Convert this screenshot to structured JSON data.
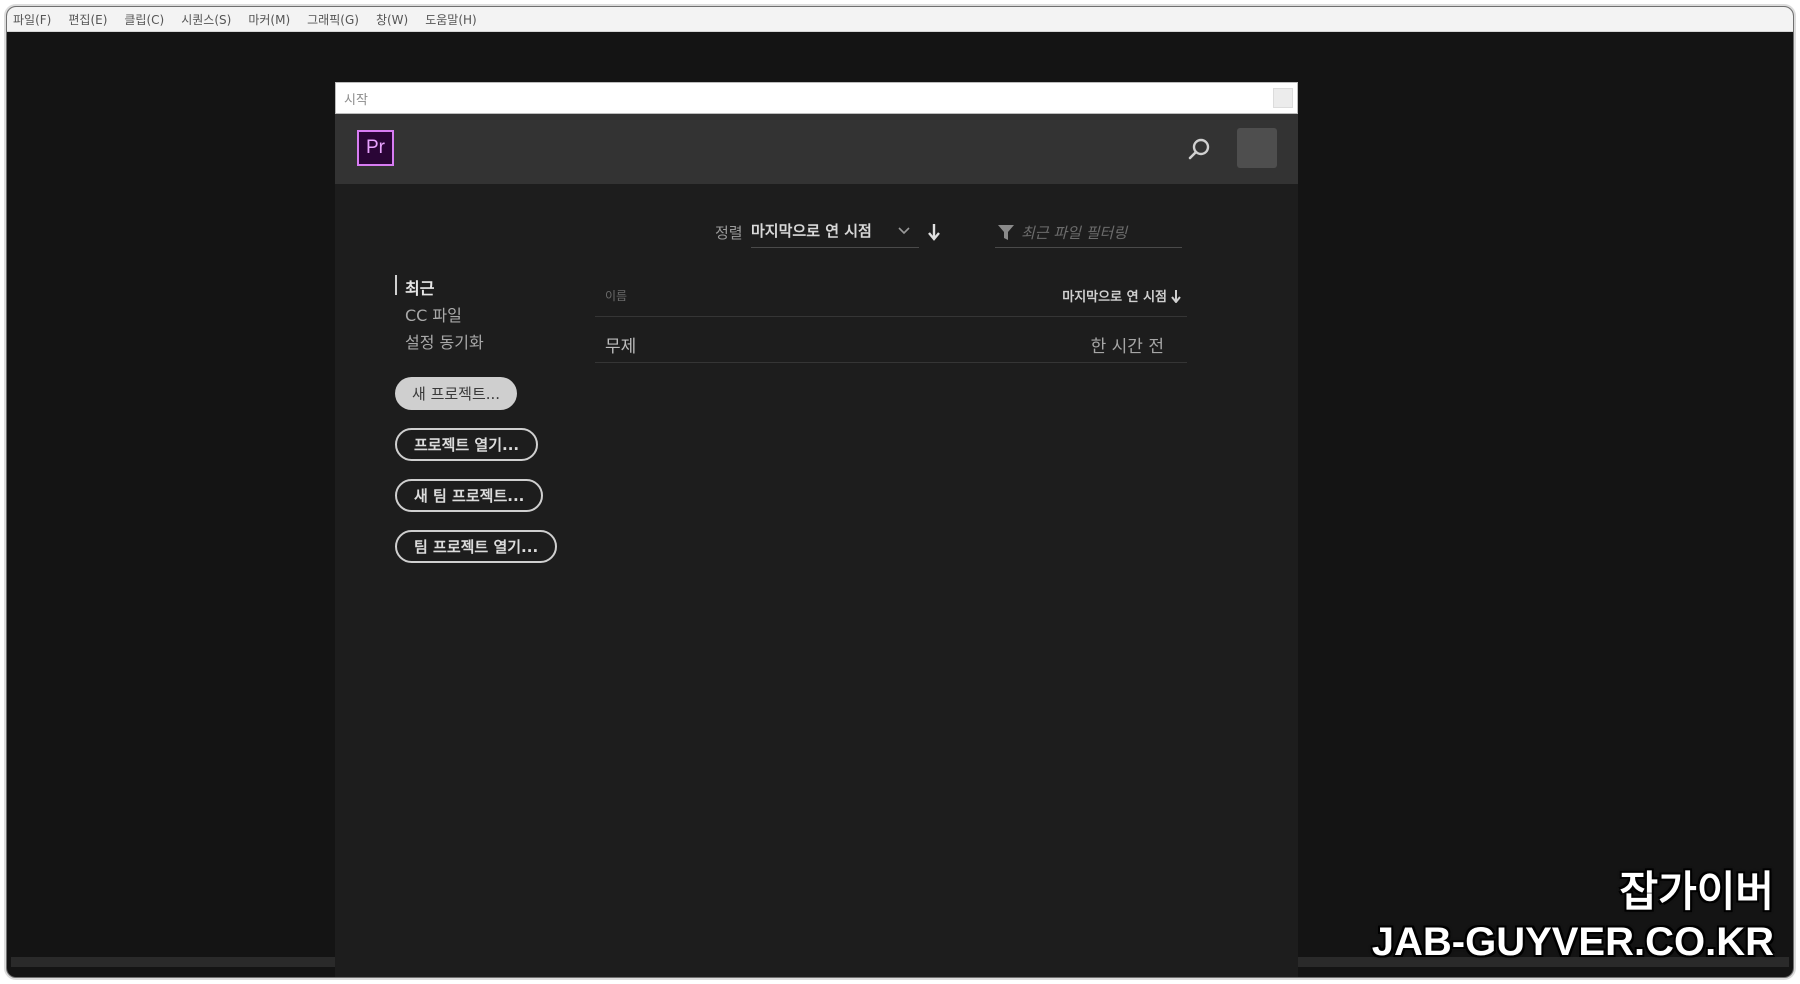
{
  "menubar": {
    "items": [
      "파일(F)",
      "편집(E)",
      "클립(C)",
      "시퀀스(S)",
      "마커(M)",
      "그래픽(G)",
      "창(W)",
      "도움말(H)"
    ]
  },
  "dialog": {
    "title": "시작",
    "logo_text": "Pr",
    "header_icons": [
      "search-icon",
      "avatar"
    ],
    "sort": {
      "label": "정렬",
      "value": "마지막으로 연 시점",
      "chevron_icon": "chevron-down-icon",
      "direction_icon": "arrow-down-icon"
    },
    "filter": {
      "icon": "filter-icon",
      "placeholder": "최근 파일 필터링"
    },
    "nav": {
      "items": [
        "최근",
        "CC 파일",
        "설정 동기화"
      ],
      "active": "최근"
    },
    "buttons": {
      "new_project": "새 프로젝트...",
      "open_project": "프로젝트 열기...",
      "new_team_project": "새 팀 프로젝트...",
      "open_team_project": "팀 프로젝트 열기..."
    },
    "table": {
      "columns": {
        "name": "이름",
        "date": "마지막으로 연 시점"
      },
      "rows": [
        {
          "name": "무제",
          "date": "한 시간 전"
        }
      ]
    }
  },
  "watermark": {
    "line1": "잡가이버",
    "line2": "JAB-GUYVER.CO.KR"
  },
  "colors": {
    "premiere_accent": "#d87cf3",
    "background": "#1d1d1d",
    "header": "#333333"
  }
}
